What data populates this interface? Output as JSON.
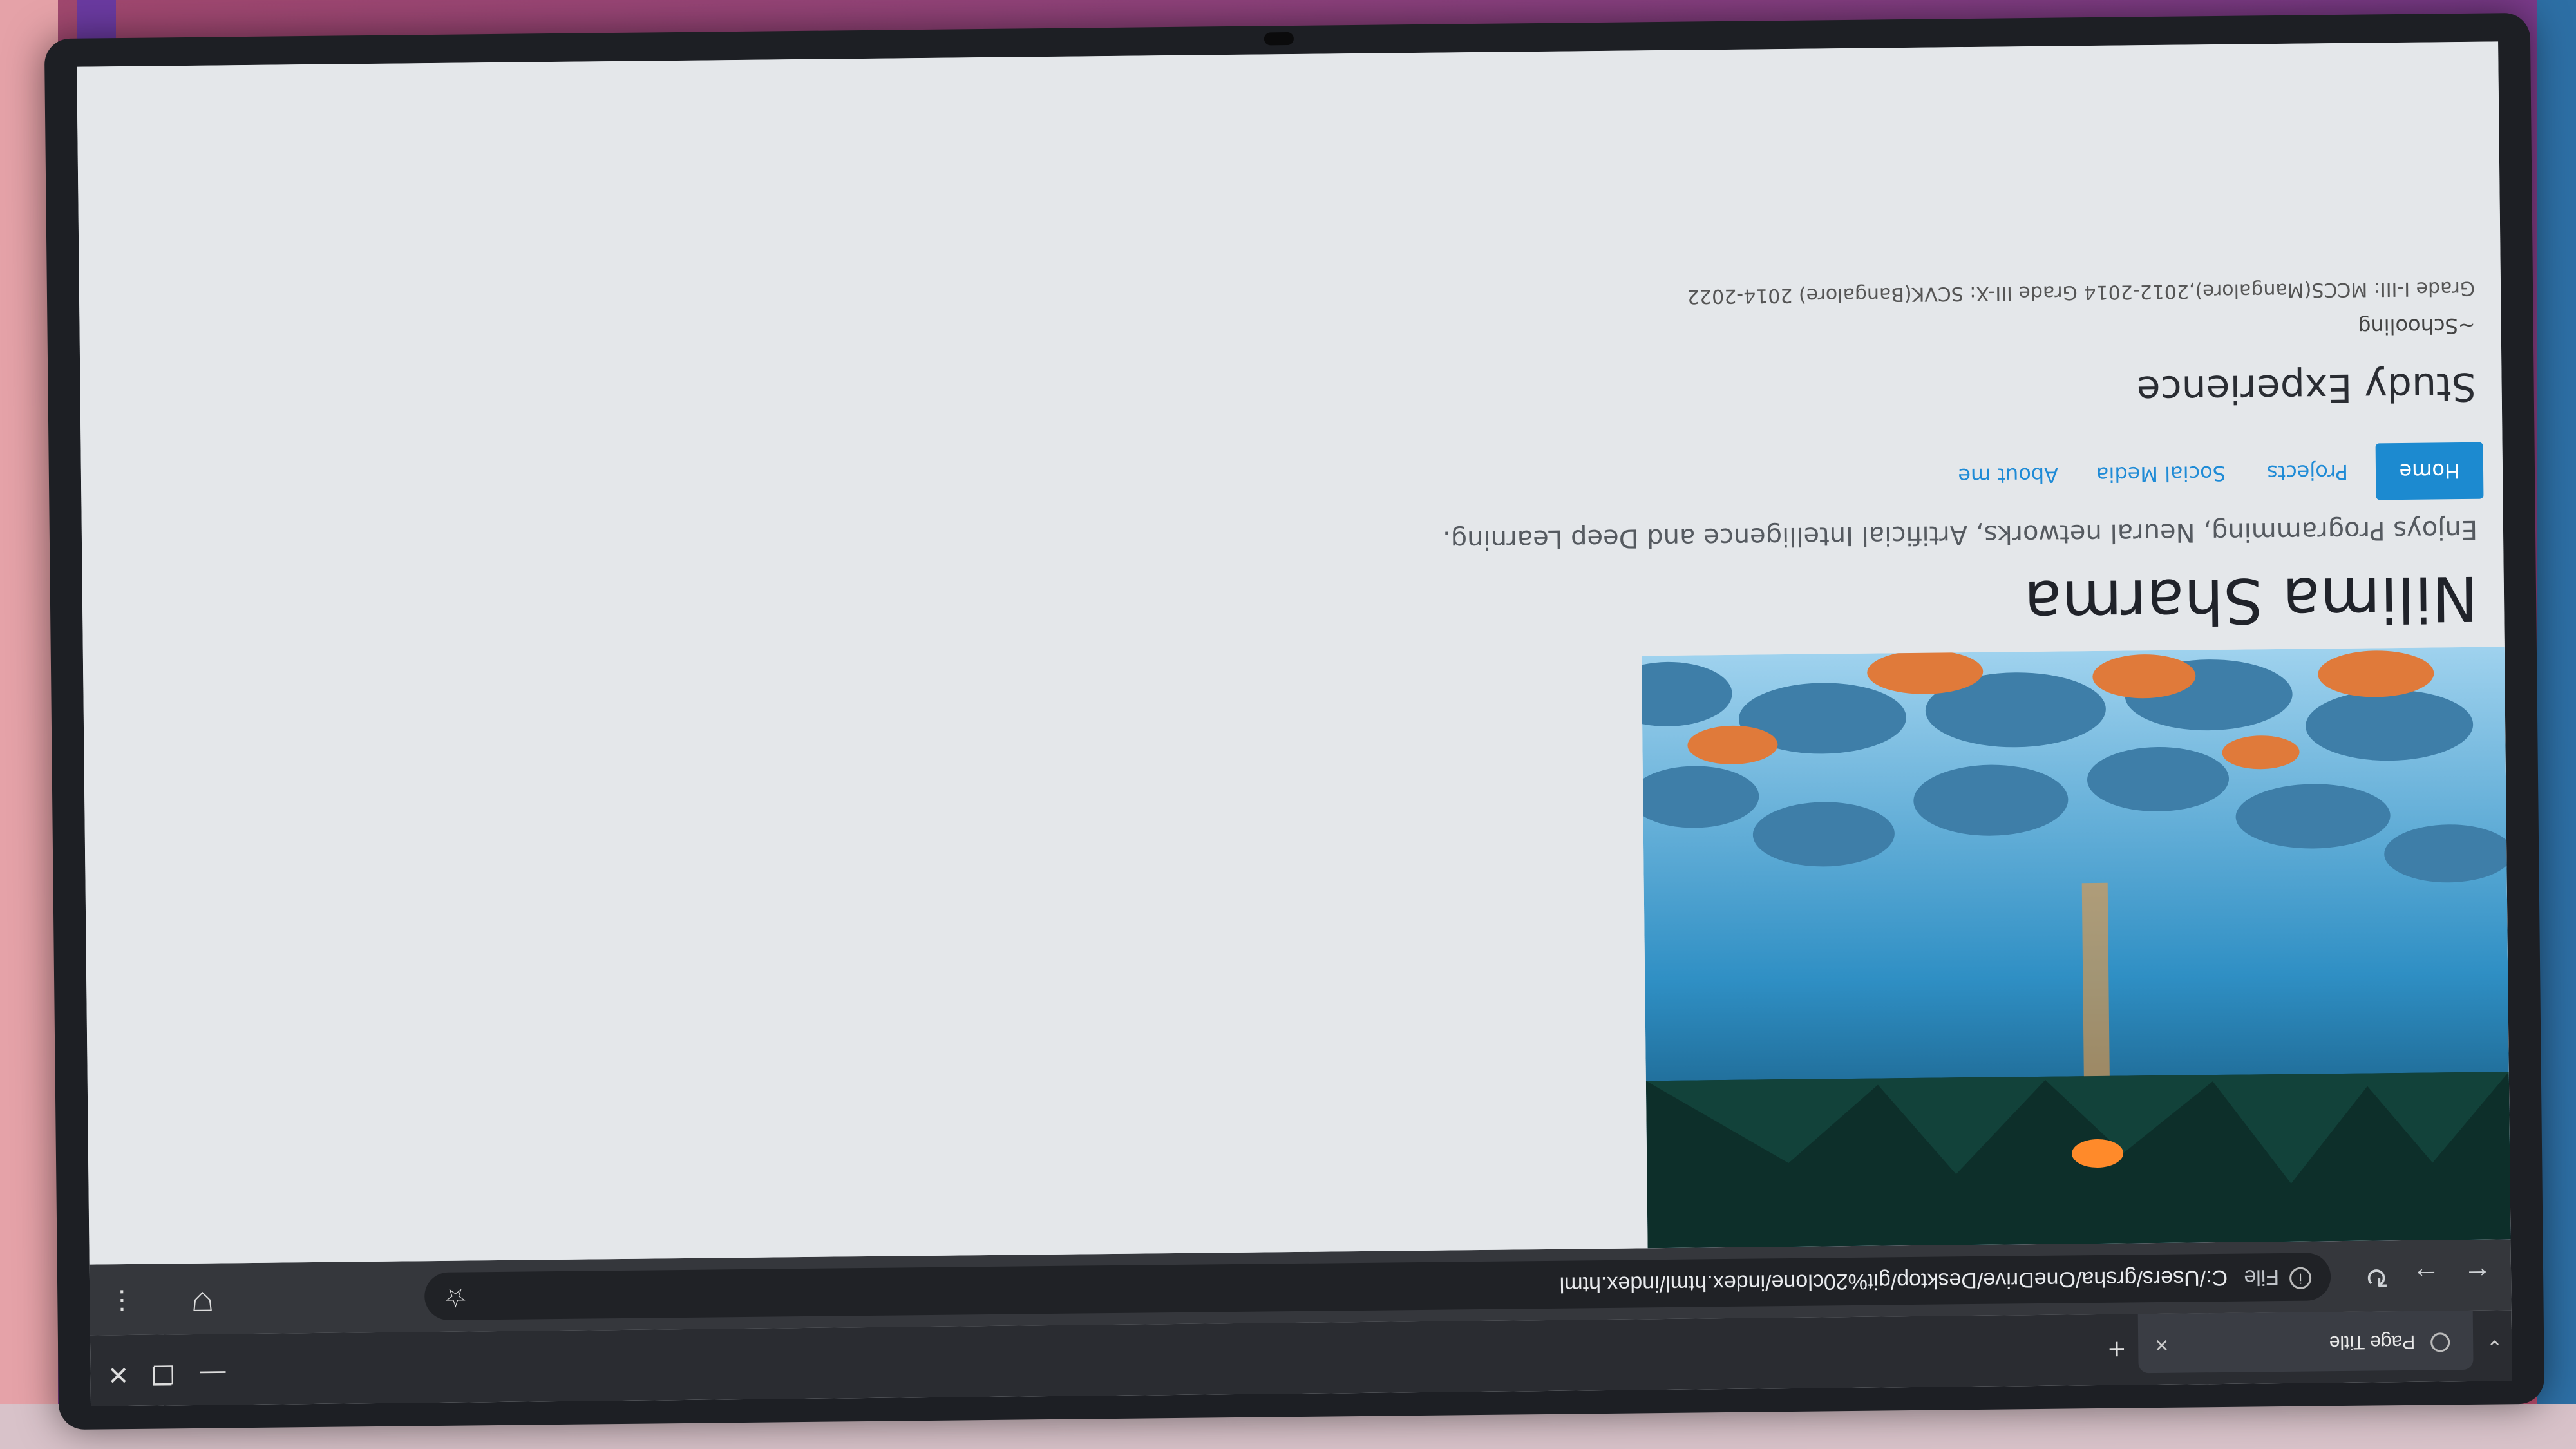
{
  "browser": {
    "tab_title": "Page Title",
    "tab_close": "×",
    "new_tab": "+",
    "scheme_label": "File",
    "url": "C:/Users/grsha/OneDrive/Desktop/git%20clone/index.html/index.html",
    "window_controls": {
      "minimize": "—",
      "restore": "❐",
      "close": "✕"
    }
  },
  "page": {
    "name": "Nilima Sharma",
    "tagline": "Enjoys Programming, Neural networks, Artificial Intelligence and Deep Learning.",
    "nav": [
      {
        "label": "Home",
        "active": true
      },
      {
        "label": "Projects",
        "active": false
      },
      {
        "label": "Social Media",
        "active": false
      },
      {
        "label": "About me",
        "active": false
      }
    ],
    "study_heading": "Study Experience",
    "schooling_label": "~Schooling",
    "schooling_detail": "Grade I-III: MCCS(Mangalore),2012-2014 Grade III-X: SCVK(Bangalore) 2014-2022"
  },
  "colors": {
    "accent": "#1c8ad0",
    "page_background": "#e4e7ea",
    "browser_chrome": "#2a2c31"
  },
  "icons": [
    "tab-list-icon",
    "globe-icon",
    "back-icon",
    "forward-icon",
    "reload-icon",
    "info-icon",
    "bookmark-star-icon",
    "extensions-icon",
    "menu-icon",
    "minimize-icon",
    "restore-icon",
    "close-icon"
  ]
}
